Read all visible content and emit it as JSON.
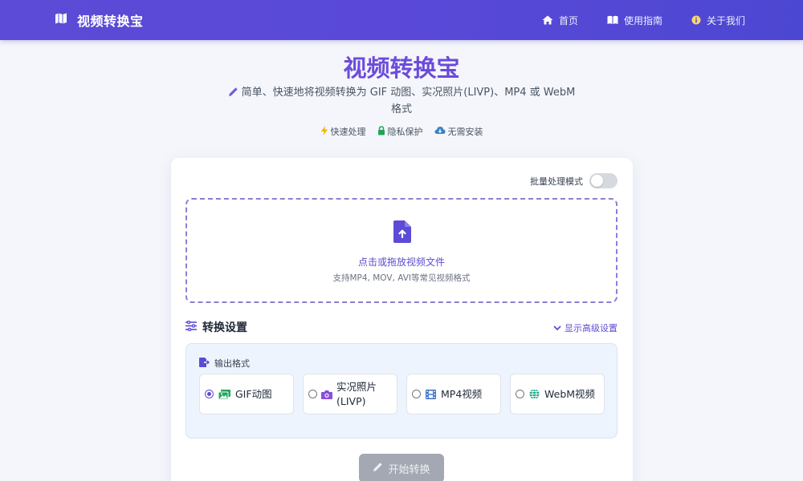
{
  "nav": {
    "brand": "视频转换宝",
    "links": [
      {
        "label": "首页",
        "icon": "home-icon"
      },
      {
        "label": "使用指南",
        "icon": "book-icon"
      },
      {
        "label": "关于我们",
        "icon": "info-icon"
      }
    ]
  },
  "hero": {
    "title": "视频转换宝",
    "subtitle": "简单、快速地将视频转换为 GIF 动图、实况照片(LIVP)、MP4 或 WebM 格式",
    "features": [
      {
        "label": "快速处理",
        "icon": "bolt-icon",
        "color": "#f5b301"
      },
      {
        "label": "隐私保护",
        "icon": "lock-icon",
        "color": "#22a55a"
      },
      {
        "label": "无需安装",
        "icon": "cloud-download-icon",
        "color": "#3b82c4"
      }
    ]
  },
  "card": {
    "batch_label": "批量处理模式",
    "batch_enabled": false,
    "dropzone": {
      "main": "点击或拖放视频文件",
      "sub": "支持MP4, MOV, AVI等常见视频格式"
    },
    "settings": {
      "title": "转换设置",
      "advanced_label": "显示高级设置",
      "output_label": "输出格式",
      "formats": [
        {
          "label": "GIF动图",
          "icon": "image-icon",
          "color": "#22a55a",
          "checked": true
        },
        {
          "label": "实况照片(LIVP)",
          "icon": "camera-icon",
          "color": "#8b4fd8",
          "checked": false
        },
        {
          "label": "MP4视频",
          "icon": "film-icon",
          "color": "#3b6fc4",
          "checked": false
        },
        {
          "label": "WebM视频",
          "icon": "globe-icon",
          "color": "#1fa88a",
          "checked": false
        }
      ]
    },
    "start_label": "开始转换"
  },
  "colors": {
    "accent": "#5b4ccf",
    "navbar": "#5a49d8",
    "button_disabled": "#a3a8b2"
  }
}
